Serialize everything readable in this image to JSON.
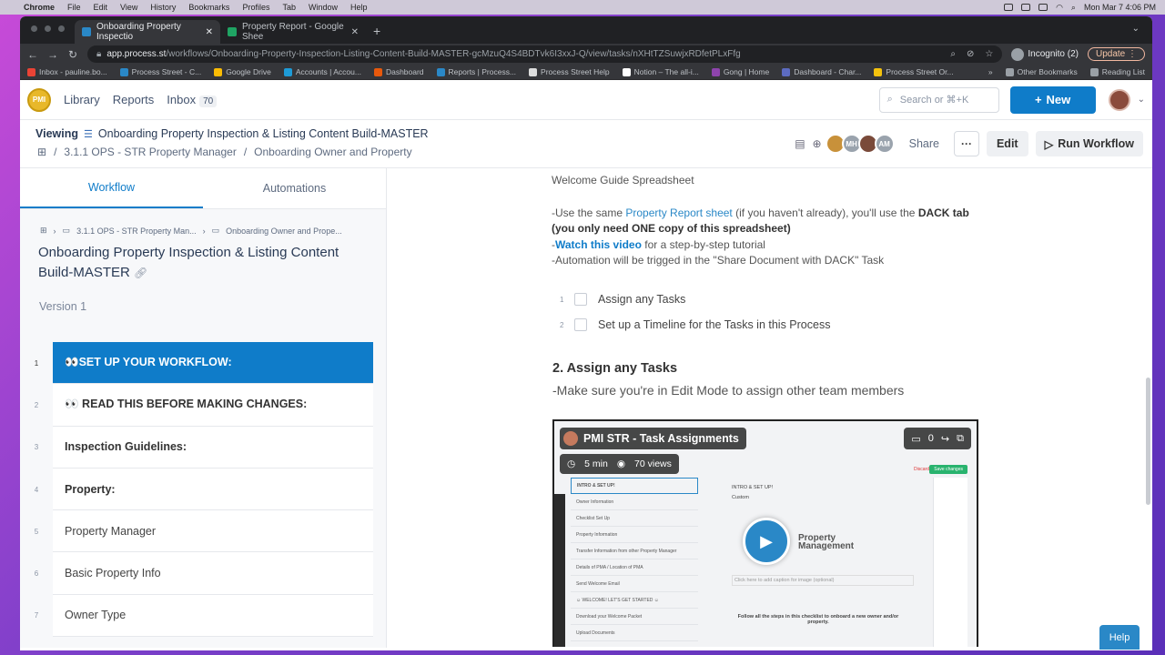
{
  "macos": {
    "app": "Chrome",
    "menu": [
      "File",
      "Edit",
      "View",
      "History",
      "Bookmarks",
      "Profiles",
      "Tab",
      "Window",
      "Help"
    ],
    "clock": "Mon Mar 7  4:06 PM"
  },
  "browser": {
    "tabs": [
      {
        "title": "Onboarding Property Inspectio",
        "favicon_color": "#2a88c7"
      },
      {
        "title": "Property Report - Google Shee",
        "favicon_color": "#1fa463"
      }
    ],
    "url_prefix": "app.process.st",
    "url_rest": "/workflows/Onboarding-Property-Inspection-Listing-Content-Build-MASTER-gcMzuQ4S4BDTvk6I3xxJ-Q/view/tasks/nXHtTZSuwjxRDfetPLxFfg",
    "incognito": "Incognito (2)",
    "update": "Update",
    "bookmarks": [
      {
        "label": "Inbox - pauline.bo...",
        "color": "#ea4335"
      },
      {
        "label": "Process Street - C...",
        "color": "#2a88c7"
      },
      {
        "label": "Google Drive",
        "color": "#fbbc04"
      },
      {
        "label": "Accounts | Accou...",
        "color": "#1e9bd7"
      },
      {
        "label": "Dashboard",
        "color": "#e8590c"
      },
      {
        "label": "Reports | Process...",
        "color": "#2a88c7"
      },
      {
        "label": "Process Street Help",
        "color": "#dddddd"
      },
      {
        "label": "Notion – The all-i...",
        "color": "#ffffff"
      },
      {
        "label": "Gong | Home",
        "color": "#8e44ad"
      },
      {
        "label": "Dashboard - Char...",
        "color": "#5c6bc0"
      },
      {
        "label": "Process Street Or...",
        "color": "#f4c20d"
      }
    ],
    "other_bookmarks": "Other Bookmarks",
    "reading_list": "Reading List"
  },
  "app_header": {
    "logo": "PMI",
    "nav": {
      "library": "Library",
      "reports": "Reports",
      "inbox": "Inbox",
      "inbox_count": "70"
    },
    "search_placeholder": "Search or ⌘+K",
    "new_button": "New"
  },
  "workflow_header": {
    "viewing": "Viewing",
    "title": "Onboarding Property Inspection & Listing Content Build-MASTER",
    "breadcrumb": [
      "3.1.1 OPS - STR Property Manager",
      "Onboarding Owner and Property"
    ],
    "avatars": [
      {
        "initials": "",
        "color": "#c8913a"
      },
      {
        "initials": "MH",
        "color": "#9aa3ad"
      },
      {
        "initials": "",
        "color": "#7a4a3a"
      },
      {
        "initials": "AM",
        "color": "#9aa3ad"
      }
    ],
    "share": "Share",
    "more": "···",
    "edit": "Edit",
    "run": "Run Workflow"
  },
  "sidebar": {
    "tabs": [
      "Workflow",
      "Automations"
    ],
    "breadcrumb": [
      "3.1.1 OPS - STR Property Man...",
      "Onboarding Owner and Prope..."
    ],
    "title": "Onboarding Property Inspection & Listing Content Build-MASTER",
    "version": "Version 1",
    "tasks": [
      {
        "num": "1",
        "label": "👀SET UP YOUR WORKFLOW:",
        "bold": true,
        "active": true
      },
      {
        "num": "2",
        "label": "👀 READ THIS BEFORE MAKING CHANGES:",
        "bold": true
      },
      {
        "num": "3",
        "label": "Inspection Guidelines:",
        "bold": true
      },
      {
        "num": "4",
        "label": "Property:",
        "bold": true
      },
      {
        "num": "5",
        "label": "Property Manager",
        "bold": false
      },
      {
        "num": "6",
        "label": "Basic Property Info",
        "bold": false
      },
      {
        "num": "7",
        "label": "Owner Type",
        "bold": false
      }
    ]
  },
  "content": {
    "heading_line": "Welcome Guide Spreadsheet",
    "p1_a": "-Use the same ",
    "p1_link": "Property Report sheet",
    "p1_b": " (if you haven't already), you'll use the ",
    "p1_bold": "DACK tab (you only need ONE copy of this spreadsheet)",
    "p2_dash": "-",
    "p2_link": "Watch this video",
    "p2_b": " for a step-by-step tutorial",
    "p3": "-Automation will be trigged in the \"Share Document with DACK\" Task",
    "checklist": [
      {
        "num": "1",
        "label": "Assign any Tasks"
      },
      {
        "num": "2",
        "label": "Set up a Timeline for the Tasks in this Process"
      }
    ],
    "section_title": "2. Assign any Tasks",
    "section_sub": "-Make sure you're in Edit Mode to assign other team members",
    "video": {
      "title": "PMI STR - Task Assignments",
      "duration": "5 min",
      "views": "70 views",
      "comments": "0",
      "list": [
        "INTRO & SET UP!",
        "Owner Information",
        "Checklist Set Up",
        "Property Information",
        "Transfer Information from other Property Manager",
        "Details of PMA / Location of PMA",
        "Send Welcome Email",
        "☺ WELCOME! LET'S GET STARTED ☺",
        "Download your Welcome Packet",
        "Upload Documents"
      ],
      "main_heading": "INTRO & SET UP!",
      "main_sub": "Custom",
      "brand": "Property\nManagement",
      "caption": "Click here to add caption for image (optional)",
      "footer": "Follow all the steps in this checklist to onboard a new owner and/or property.",
      "save": "Save changes",
      "discard": "Discard"
    }
  },
  "help": "Help"
}
